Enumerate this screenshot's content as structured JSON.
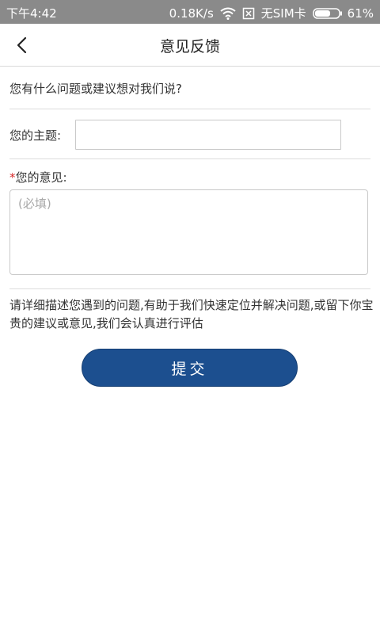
{
  "status_bar": {
    "time": "下午4:42",
    "speed": "0.18K/s",
    "sim": "无SIM卡",
    "battery": "61%"
  },
  "header": {
    "title": "意见反馈"
  },
  "form": {
    "prompt": "您有什么问题或建议想对我们说?",
    "subject_label": "您的主题:",
    "subject_value": "",
    "opinion_required_mark": "*",
    "opinion_label": "您的意见:",
    "opinion_placeholder": "(必填)",
    "description": "请详细描述您遇到的问题,有助于我们快速定位并解决问题,或留下你宝贵的建议或意见,我们会认真进行评估",
    "submit_label": "提交"
  },
  "colors": {
    "status_bar": "#8a8a8a",
    "button": "#1c4f8f",
    "required": "#d62a2a"
  }
}
